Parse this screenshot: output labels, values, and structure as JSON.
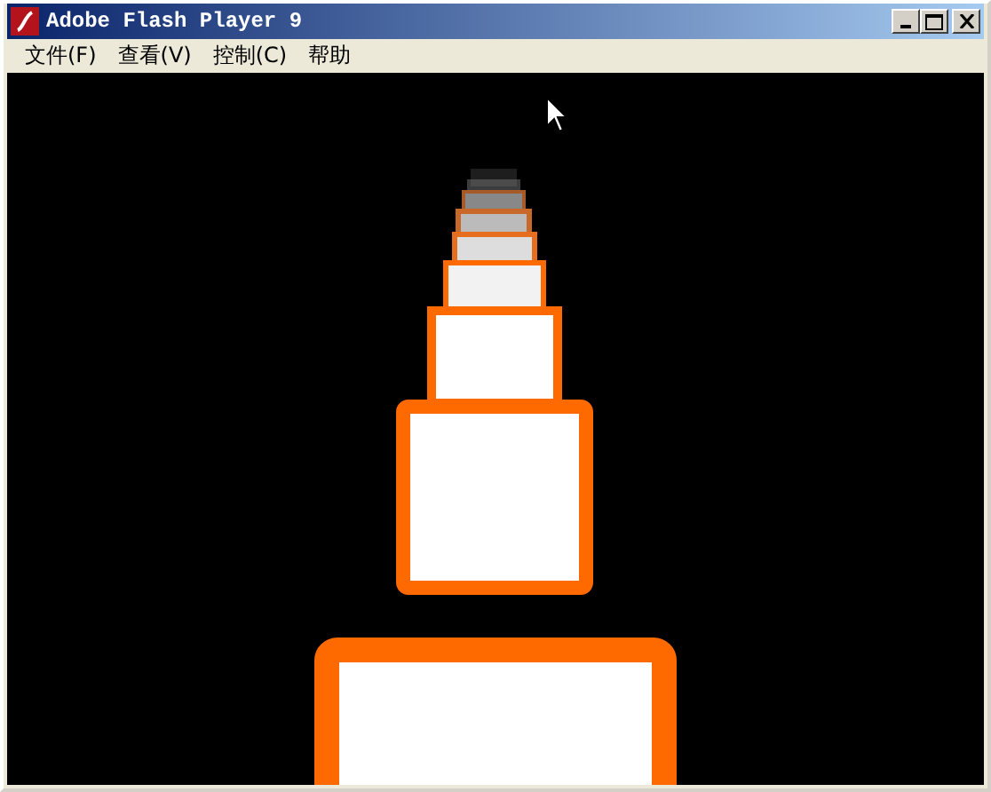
{
  "window": {
    "title": "Adobe Flash Player 9"
  },
  "menu": [
    {
      "label": "文件(F)"
    },
    {
      "label": "查看(V)"
    },
    {
      "label": "控制(C)"
    },
    {
      "label": "帮助"
    }
  ]
}
